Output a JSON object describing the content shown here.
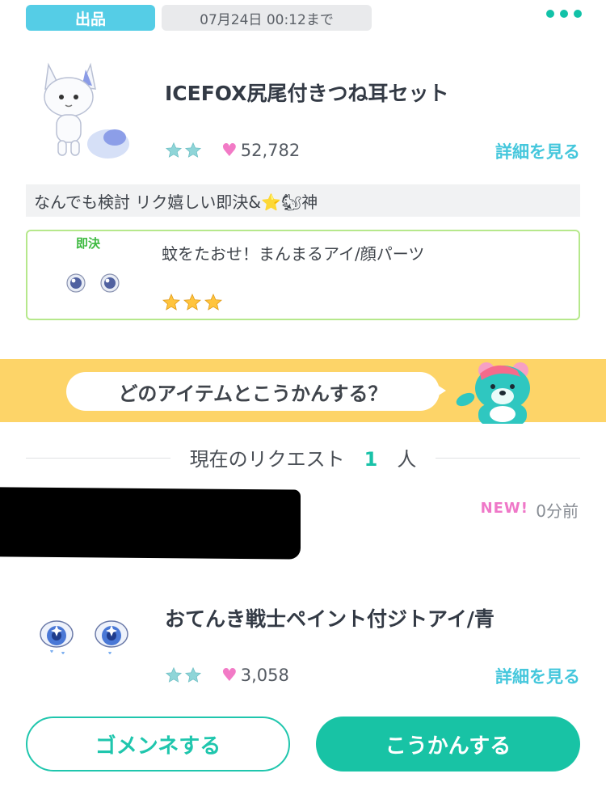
{
  "header": {
    "listing_badge": "出品",
    "deadline": "07月24日 00:12まで",
    "menu_icon": "more-dots-icon"
  },
  "listing": {
    "item_name": "ICEFOX尻尾付きつね耳セット",
    "rarity_stars": 2,
    "likes": "52,782",
    "detail_link": "詳細を見る",
    "comment": "なんでも検討 リク嬉しい即決&⭐🐿神"
  },
  "wanted": {
    "instant_label": "即決",
    "item_name": "蚊をたおせ！まんまるアイ/顔パーツ",
    "rarity_stars": 3
  },
  "banner": {
    "question": "どのアイテムとこうかんする？"
  },
  "requests": {
    "title_prefix": "現在のリクエスト",
    "count": "1",
    "title_suffix": "人",
    "new_label": "NEW!",
    "time_ago": "0分前"
  },
  "offer": {
    "item_name": "おてんき戦士ペイント付ジトアイ/青",
    "rarity_stars": 2,
    "likes": "3,058",
    "detail_link": "詳細を見る"
  },
  "buttons": {
    "decline": "ゴメンネする",
    "accept": "こうかんする"
  },
  "colors": {
    "accent_teal": "#18c3a5",
    "link_blue": "#45c7dc",
    "badge_blue": "#55cde6",
    "banner_yellow": "#fdd468",
    "heart_pink": "#f27ac6"
  }
}
